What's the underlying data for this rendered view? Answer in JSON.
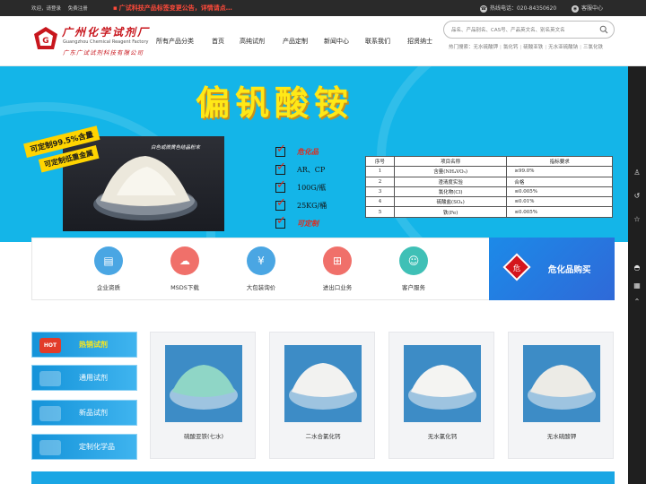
{
  "topbar": {
    "welcome": "欢迎，请登录",
    "register": "免费注册",
    "notice": "广试科技产品标签变更公告，详情请点…",
    "hotline_label": "热线电话：",
    "hotline_number": "020-84350620",
    "service_label": "客服中心"
  },
  "logo": {
    "cn": "广州化学试剂厂",
    "en": "Guangzhou Chemical Reagent Factory",
    "sub": "广东广试试剂科技有限公司"
  },
  "nav": {
    "items": [
      "所有产品分类",
      "首页",
      "高纯试剂",
      "产品定制",
      "新闻中心",
      "联系我们",
      "招贤纳士"
    ]
  },
  "search": {
    "placeholder": "品名、产品别名、CAS号、产品英文名、别名英文名",
    "hot_label": "热门搜索：",
    "hot_terms": [
      "无水硫酸钾",
      "氯化钙",
      "硫酸亚铁",
      "无水亚硫酸钠",
      "三氯化铁"
    ]
  },
  "banner": {
    "title": "偏钒酸铵",
    "ribbon_line1": "可定制99.5%含量",
    "ribbon_line2": "可定制低重金属",
    "photo_caption": "白色或微黄色结晶粉末",
    "checks": [
      "危化品",
      "AR、CP",
      "100G/瓶",
      "25KG/桶",
      "可定制"
    ],
    "spec_table": {
      "headers": [
        "序号",
        "项目名称",
        "指标要求"
      ],
      "rows": [
        [
          "1",
          "含量(NH₄VO₃)",
          "≥99.0%"
        ],
        [
          "2",
          "澄清度实验",
          "合格"
        ],
        [
          "3",
          "氯化物(Cl)",
          "≤0.005%"
        ],
        [
          "4",
          "硫酸盐(SO₄)",
          "≤0.01%"
        ],
        [
          "5",
          "铁(Fe)",
          "≤0.005%"
        ]
      ]
    }
  },
  "services": [
    {
      "label": "企业资质",
      "icon": "certificate-icon",
      "color": "#4aa6e3"
    },
    {
      "label": "MSDS下载",
      "icon": "cloud-download-icon",
      "color": "#f0706a"
    },
    {
      "label": "大包装询价",
      "icon": "price-icon",
      "color": "#4aa6e3"
    },
    {
      "label": "进出口业务",
      "icon": "import-export-icon",
      "color": "#f0706a"
    },
    {
      "label": "客户服务",
      "icon": "customer-service-icon",
      "color": "#3fc0b6"
    }
  ],
  "hazard_buy": {
    "icon_text": "危",
    "label": "危化品购买"
  },
  "categories": [
    {
      "label": "热销试剂",
      "icon": "HOT",
      "highlight": true
    },
    {
      "label": "通用试剂",
      "icon": "",
      "highlight": false
    },
    {
      "label": "新品试剂",
      "icon": "",
      "highlight": false
    },
    {
      "label": "定制化学品",
      "icon": "",
      "highlight": false
    }
  ],
  "products": [
    {
      "name": "硫酸亚铁(七水)",
      "color": "#8fd6c6"
    },
    {
      "name": "二水合氯化钙",
      "color": "#f2f2f0"
    },
    {
      "name": "无水氯化钙",
      "color": "#f4f4f2"
    },
    {
      "name": "无水硫酸钾",
      "color": "#ecebe6"
    }
  ]
}
